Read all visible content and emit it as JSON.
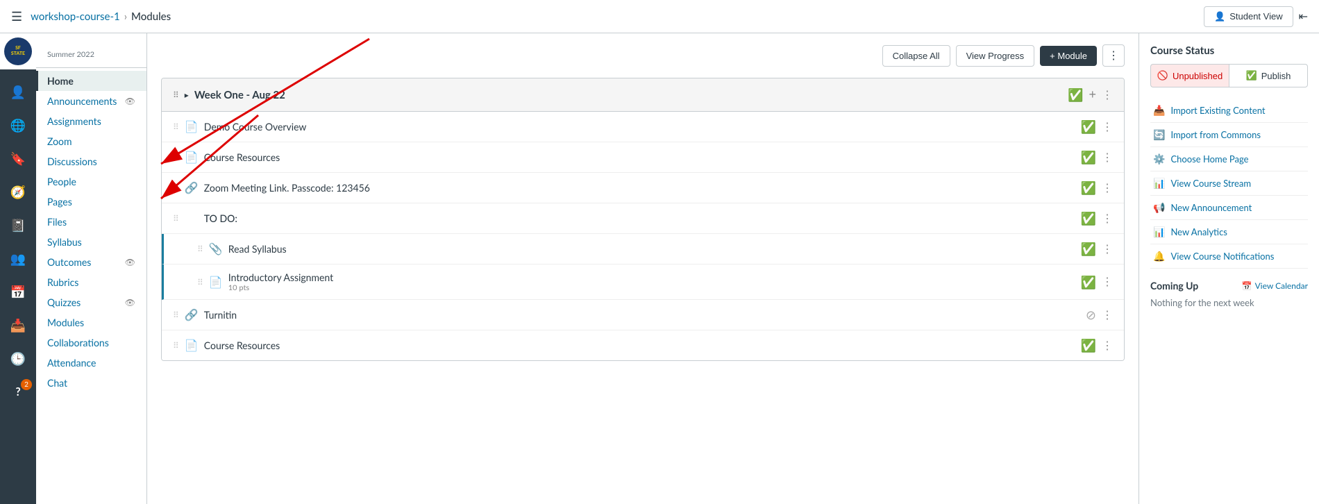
{
  "topbar": {
    "hamburger": "☰",
    "breadcrumb_course": "workshop-course-1",
    "breadcrumb_sep": "›",
    "breadcrumb_current": "Modules",
    "student_view_icon": "👤",
    "student_view_label": "Student View",
    "collapse_icon": "⇤"
  },
  "icon_sidebar": {
    "icons": [
      {
        "name": "account-icon",
        "symbol": "👤",
        "badge": null
      },
      {
        "name": "globe-icon",
        "symbol": "🌐",
        "badge": null
      },
      {
        "name": "bookmark-icon",
        "symbol": "🔖",
        "badge": null
      },
      {
        "name": "compass-icon",
        "symbol": "🧭",
        "badge": null
      },
      {
        "name": "notebook-icon",
        "symbol": "📓",
        "badge": null
      },
      {
        "name": "people-icon",
        "symbol": "👥",
        "badge": null
      },
      {
        "name": "calendar-icon",
        "symbol": "📅",
        "badge": null
      },
      {
        "name": "inbox-icon",
        "symbol": "📥",
        "badge": null
      },
      {
        "name": "history-icon",
        "symbol": "🕒",
        "badge": null
      },
      {
        "name": "help-icon",
        "symbol": "?",
        "badge": "2"
      }
    ]
  },
  "course_nav": {
    "semester": "Summer 2022",
    "items": [
      {
        "label": "Home",
        "active": true,
        "vis_icon": false,
        "id": "home"
      },
      {
        "label": "Announcements",
        "active": false,
        "vis_icon": true,
        "id": "announcements"
      },
      {
        "label": "Assignments",
        "active": false,
        "vis_icon": false,
        "id": "assignments"
      },
      {
        "label": "Zoom",
        "active": false,
        "vis_icon": false,
        "id": "zoom"
      },
      {
        "label": "Discussions",
        "active": false,
        "vis_icon": false,
        "id": "discussions"
      },
      {
        "label": "People",
        "active": false,
        "vis_icon": false,
        "id": "people"
      },
      {
        "label": "Pages",
        "active": false,
        "vis_icon": false,
        "id": "pages"
      },
      {
        "label": "Files",
        "active": false,
        "vis_icon": false,
        "id": "files"
      },
      {
        "label": "Syllabus",
        "active": false,
        "vis_icon": false,
        "id": "syllabus"
      },
      {
        "label": "Outcomes",
        "active": false,
        "vis_icon": true,
        "id": "outcomes"
      },
      {
        "label": "Rubrics",
        "active": false,
        "vis_icon": false,
        "id": "rubrics"
      },
      {
        "label": "Quizzes",
        "active": false,
        "vis_icon": true,
        "id": "quizzes"
      },
      {
        "label": "Modules",
        "active": false,
        "vis_icon": false,
        "id": "modules"
      },
      {
        "label": "Collaborations",
        "active": false,
        "vis_icon": false,
        "id": "collaborations"
      },
      {
        "label": "Attendance",
        "active": false,
        "vis_icon": false,
        "id": "attendance"
      },
      {
        "label": "Chat",
        "active": false,
        "vis_icon": false,
        "id": "chat"
      }
    ]
  },
  "toolbar": {
    "collapse_all_label": "Collapse All",
    "view_progress_label": "View Progress",
    "add_module_label": "+ Module",
    "kebab": "⋮"
  },
  "module": {
    "title": "Week One - Aug 22",
    "items": [
      {
        "id": "item1",
        "icon": "📄",
        "title": "Demo Course Overview",
        "subtitle": "",
        "published": true,
        "indent": false
      },
      {
        "id": "item2",
        "icon": "📄",
        "title": "Course Resources",
        "subtitle": "",
        "published": true,
        "indent": false
      },
      {
        "id": "item3",
        "icon": "🔗",
        "title": "Zoom Meeting Link. Passcode: 123456",
        "subtitle": "",
        "published": true,
        "indent": false
      },
      {
        "id": "item4",
        "icon": "",
        "title": "TO DO:",
        "subtitle": "",
        "published": true,
        "indent": false
      },
      {
        "id": "item5",
        "icon": "📎",
        "title": "Read Syllabus",
        "subtitle": "",
        "published": true,
        "indent": true
      },
      {
        "id": "item6",
        "icon": "📄",
        "title": "Introductory Assignment",
        "subtitle": "10 pts",
        "published": true,
        "indent": true
      },
      {
        "id": "item7",
        "icon": "🔗",
        "title": "Turnitin",
        "subtitle": "",
        "published": false,
        "indent": false
      },
      {
        "id": "item8",
        "icon": "📄",
        "title": "Course Resources",
        "subtitle": "",
        "published": true,
        "indent": false
      }
    ]
  },
  "right_sidebar": {
    "course_status_title": "Course Status",
    "unpublished_label": "Unpublished",
    "publish_label": "Publish",
    "unpublished_icon": "🚫",
    "publish_icon": "✅",
    "actions": [
      {
        "id": "import-existing",
        "icon": "📥",
        "label": "Import Existing Content"
      },
      {
        "id": "import-commons",
        "icon": "🔄",
        "label": "Import from Commons"
      },
      {
        "id": "choose-home",
        "icon": "⚙️",
        "label": "Choose Home Page"
      },
      {
        "id": "view-stream",
        "icon": "📊",
        "label": "View Course Stream"
      },
      {
        "id": "new-announcement",
        "icon": "📢",
        "label": "New Announcement"
      },
      {
        "id": "new-analytics",
        "icon": "📊",
        "label": "New Analytics"
      },
      {
        "id": "view-notifications",
        "icon": "🔔",
        "label": "View Course Notifications"
      }
    ],
    "coming_up_title": "Coming Up",
    "view_calendar_label": "View Calendar",
    "nothing_text": "Nothing for the next week"
  }
}
